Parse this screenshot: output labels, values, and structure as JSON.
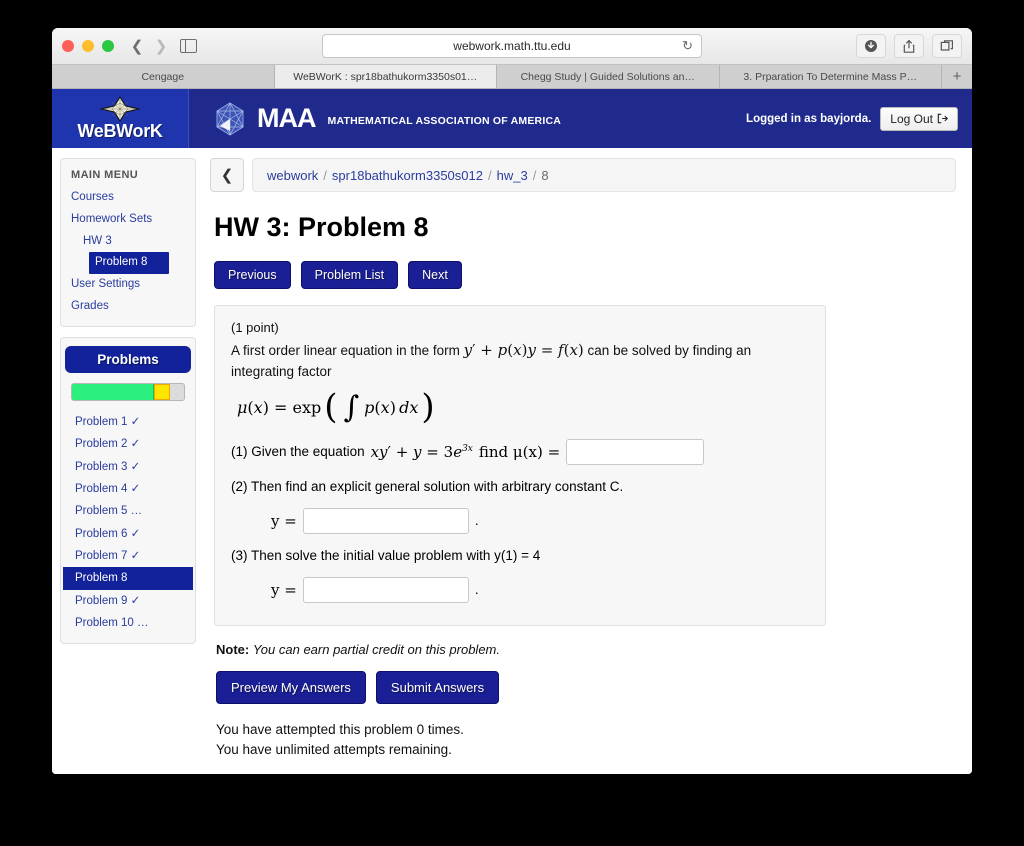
{
  "browser": {
    "url": "webwork.math.ttu.edu",
    "reload_icon": "reload-icon",
    "back_icon": "chevron-left-icon",
    "forward_icon": "chevron-right-icon",
    "sidebar_icon": "sidebar-toggle-icon",
    "downloads_icon": "downloads-icon",
    "share_icon": "share-icon",
    "tabs_icon": "tab-overview-icon",
    "new_tab_label": "+",
    "tabs": [
      {
        "label": "Cengage",
        "active": false
      },
      {
        "label": "WeBWorK : spr18bathukorm3350s01…",
        "active": true
      },
      {
        "label": "Chegg Study | Guided Solutions an…",
        "active": false
      },
      {
        "label": "3. Prparation To Determine Mass P…",
        "active": false
      }
    ]
  },
  "header": {
    "logo_text": "WeBWorK",
    "logo_icon": "webwork-star-icon",
    "maa_icon": "maa-icosahedron-icon",
    "maa_text": "MAA",
    "maa_subtitle": "MATHEMATICAL ASSOCIATION OF AMERICA",
    "logged_in_text": "Logged in as bayjorda.",
    "logout_label": "Log Out",
    "logout_icon": "logout-arrow-icon"
  },
  "breadcrumb": {
    "back_icon": "chevron-left-icon",
    "items": [
      "webwork",
      "spr18bathukorm3350s012",
      "hw_3",
      "8"
    ],
    "separator": "/"
  },
  "sidebar": {
    "menu_title": "MAIN MENU",
    "items": [
      {
        "label": "Courses",
        "level": 0,
        "active": false
      },
      {
        "label": "Homework Sets",
        "level": 0,
        "active": false
      },
      {
        "label": "HW 3",
        "level": 1,
        "active": false
      },
      {
        "label": "Problem 8",
        "level": 2,
        "active": true
      },
      {
        "label": "User Settings",
        "level": 0,
        "active": false
      },
      {
        "label": "Grades",
        "level": 0,
        "active": false
      }
    ],
    "problems_title": "Problems",
    "progress": {
      "green_pct": 73,
      "yellow_pct": 14,
      "gray_pct": 13,
      "green_color": "#2bf07e",
      "yellow_color": "#ffe600",
      "gray_color": "#dcdcdc"
    },
    "problem_list": [
      {
        "label": "Problem 1",
        "status": "✓",
        "current": false
      },
      {
        "label": "Problem 2",
        "status": "✓",
        "current": false
      },
      {
        "label": "Problem 3",
        "status": "✓",
        "current": false
      },
      {
        "label": "Problem 4",
        "status": "✓",
        "current": false
      },
      {
        "label": "Problem 5",
        "status": "…",
        "current": false
      },
      {
        "label": "Problem 6",
        "status": "✓",
        "current": false
      },
      {
        "label": "Problem 7",
        "status": "✓",
        "current": false
      },
      {
        "label": "Problem 8",
        "status": "",
        "current": true
      },
      {
        "label": "Problem 9",
        "status": "✓",
        "current": false
      },
      {
        "label": "Problem 10",
        "status": "…",
        "current": false
      }
    ]
  },
  "main": {
    "title": "HW 3: Problem 8",
    "nav": {
      "previous": "Previous",
      "problem_list": "Problem List",
      "next": "Next"
    },
    "problem": {
      "points": "(1 point)",
      "intro_before": "A first order linear equation in the form",
      "intro_formula": "y′ + p(x)y = f(x)",
      "intro_after": "can be solved by finding an integrating factor",
      "mu_formula": "μ(x) = exp( ∫ p(x) dx )",
      "part1_before": "(1) Given the equation",
      "part1_equation": "xy′ + y = 3e",
      "part1_exponent": "3x",
      "part1_after": "find μ(x) =",
      "part1_value": "",
      "part2": "(2) Then find an explicit general solution with arbitrary constant C.",
      "part2_label": "y =",
      "part2_value": "",
      "part2_period": ".",
      "part3": "(3) Then solve the initial value problem with y(1) = 4",
      "part3_label": "y =",
      "part3_value": "",
      "part3_period": "."
    },
    "note_label": "Note:",
    "note_text": "You can earn partial credit on this problem.",
    "buttons": {
      "preview": "Preview My Answers",
      "submit": "Submit Answers"
    },
    "attempts_line1": "You have attempted this problem 0 times.",
    "attempts_line2": "You have unlimited attempts remaining."
  }
}
